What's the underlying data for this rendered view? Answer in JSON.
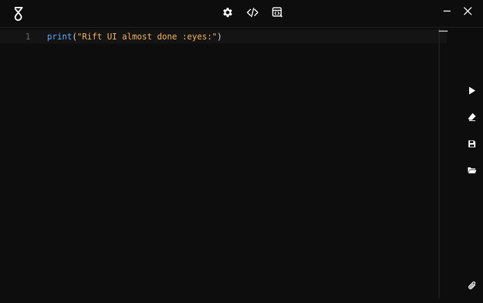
{
  "editor": {
    "lines": [
      {
        "number": "1",
        "tokens": {
          "fn": "print",
          "open": "(",
          "string": "\"Rift UI almost done :eyes:\"",
          "close": ")"
        }
      }
    ]
  },
  "toolbar": {
    "icons": [
      "gear-icon",
      "code-icon",
      "script-hub-icon"
    ]
  },
  "window": {
    "icons": [
      "minimize-icon",
      "close-icon"
    ]
  },
  "sidebar": {
    "icons": [
      "play-icon",
      "eraser-icon",
      "save-icon",
      "folder-open-icon",
      "paperclip-icon"
    ]
  },
  "colors": {
    "background": "#0d0d0d",
    "function": "#61a8ff",
    "string": "#f5b463",
    "line_number": "#6b6b6b",
    "icon": "#ffffff"
  }
}
